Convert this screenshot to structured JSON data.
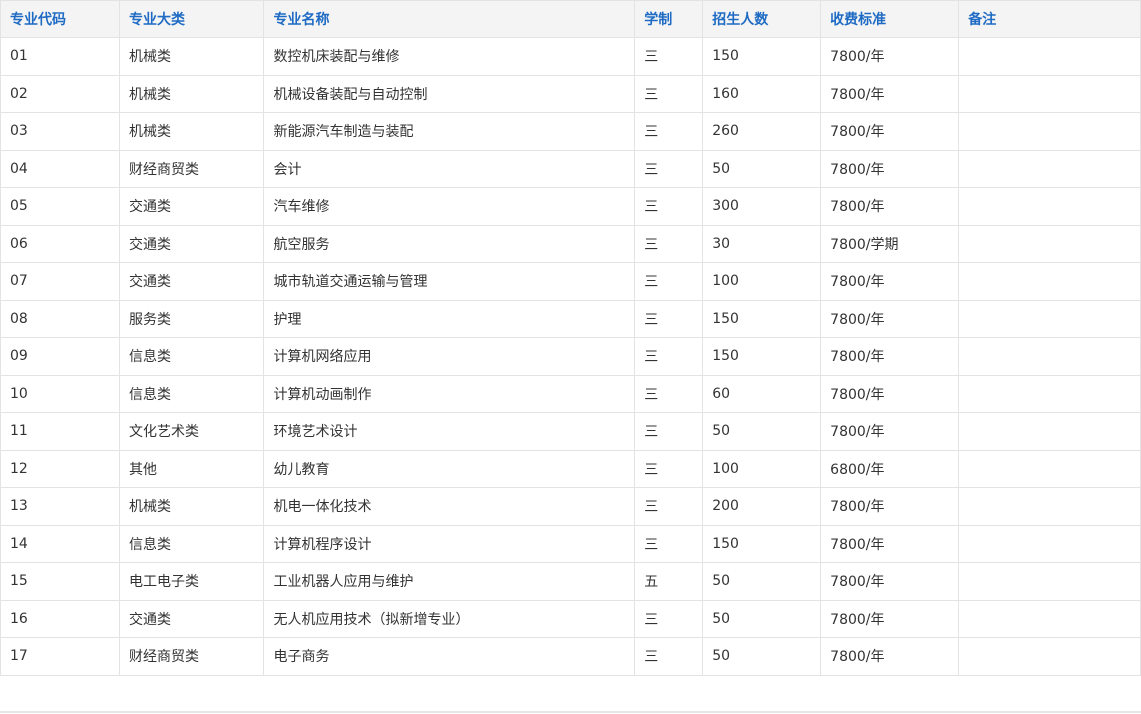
{
  "table": {
    "headers": [
      "专业代码",
      "专业大类",
      "专业名称",
      "学制",
      "招生人数",
      "收费标准",
      "备注"
    ],
    "rows": [
      [
        "01",
        "机械类",
        "数控机床装配与维修",
        "三",
        "150",
        "7800/年",
        ""
      ],
      [
        "02",
        "机械类",
        "机械设备装配与自动控制",
        "三",
        "160",
        "7800/年",
        ""
      ],
      [
        "03",
        "机械类",
        "新能源汽车制造与装配",
        "三",
        "260",
        "7800/年",
        ""
      ],
      [
        "04",
        "财经商贸类",
        "会计",
        "三",
        "50",
        "7800/年",
        ""
      ],
      [
        "05",
        "交通类",
        "汽车维修",
        "三",
        "300",
        "7800/年",
        ""
      ],
      [
        "06",
        "交通类",
        "航空服务",
        "三",
        "30",
        "7800/学期",
        ""
      ],
      [
        "07",
        "交通类",
        "城市轨道交通运输与管理",
        "三",
        "100",
        "7800/年",
        ""
      ],
      [
        "08",
        "服务类",
        "护理",
        "三",
        "150",
        "7800/年",
        ""
      ],
      [
        "09",
        "信息类",
        "计算机网络应用",
        "三",
        "150",
        "7800/年",
        ""
      ],
      [
        "10",
        "信息类",
        "计算机动画制作",
        "三",
        "60",
        "7800/年",
        ""
      ],
      [
        "11",
        "文化艺术类",
        "环境艺术设计",
        "三",
        "50",
        "7800/年",
        ""
      ],
      [
        "12",
        "其他",
        "幼儿教育",
        "三",
        "100",
        "6800/年",
        ""
      ],
      [
        "13",
        "机械类",
        "机电一体化技术",
        "三",
        "200",
        "7800/年",
        ""
      ],
      [
        "14",
        "信息类",
        "计算机程序设计",
        "三",
        "150",
        "7800/年",
        ""
      ],
      [
        "15",
        "电工电子类",
        "工业机器人应用与维护",
        "五",
        "50",
        "7800/年",
        ""
      ],
      [
        "16",
        "交通类",
        "无人机应用技术（拟新增专业）",
        "三",
        "50",
        "7800/年",
        ""
      ],
      [
        "17",
        "财经商贸类",
        "电子商务",
        "三",
        "50",
        "7800/年",
        ""
      ]
    ]
  },
  "colors": {
    "header_text": "#1f6bc4",
    "header_bg": "#f4f4f4",
    "border": "#e3e3e3",
    "body_text": "#333333"
  }
}
